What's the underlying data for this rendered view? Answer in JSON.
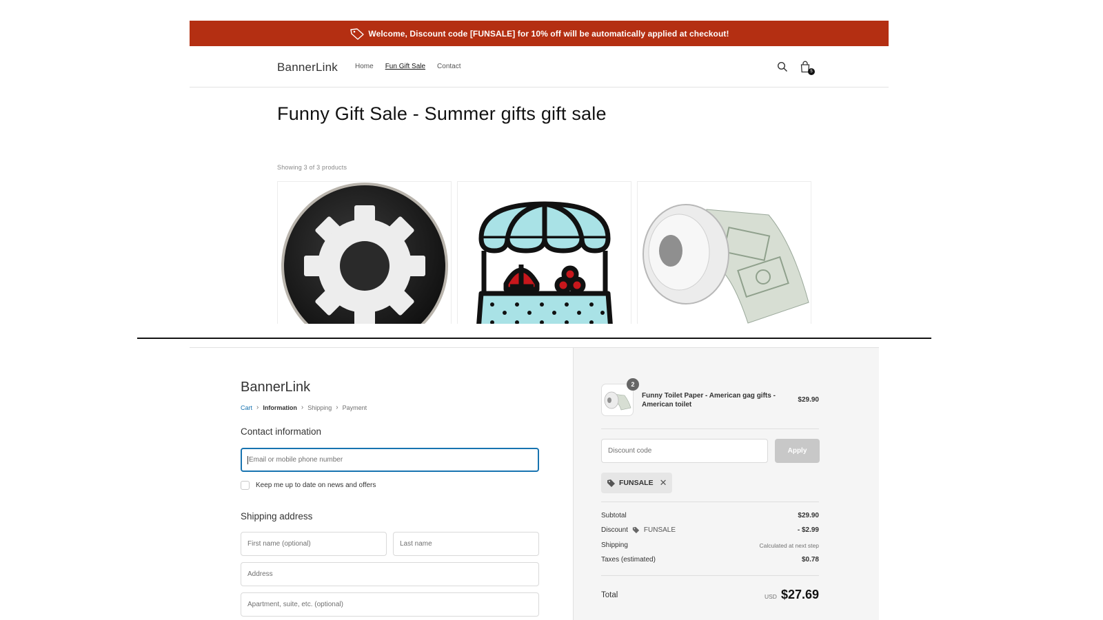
{
  "store": {
    "announcement": "Welcome, Discount code [FUNSALE] for 10% off will be automatically applied at checkout!",
    "logo": "BannerLink",
    "nav": [
      "Home",
      "Fun Gift Sale",
      "Contact"
    ],
    "cart_count": "5",
    "page_title": "Funny Gift Sale - Summer gifts gift sale",
    "showing": "Showing 3 of 3 products",
    "products": [
      {
        "icon": "gear-icon"
      },
      {
        "icon": "market-stall-icon"
      },
      {
        "icon": "toilet-paper-image"
      }
    ],
    "colors": {
      "banner": "#b42f12",
      "text": "#121212"
    }
  },
  "checkout": {
    "logo": "BannerLink",
    "breadcrumb": [
      "Cart",
      "Information",
      "Shipping",
      "Payment"
    ],
    "contact_heading": "Contact information",
    "email_placeholder": "Email or mobile phone number",
    "newsletter_label": "Keep me up to date on news and offers",
    "shipping_heading": "Shipping address",
    "first_name_placeholder": "First name (optional)",
    "last_name_placeholder": "Last name",
    "address_placeholder": "Address",
    "apartment_placeholder": "Apartment, suite, etc. (optional)",
    "item": {
      "name": "Funny Toilet Paper - American gag gifts - American toilet",
      "quantity": "2",
      "price": "$29.90"
    },
    "discount_placeholder": "Discount code",
    "apply_label": "Apply",
    "applied_code": "FUNSALE",
    "summary": {
      "subtotal_label": "Subtotal",
      "subtotal": "$29.90",
      "discount_label": "Discount",
      "discount_code": "FUNSALE",
      "discount": "- $2.99",
      "shipping_label": "Shipping",
      "shipping": "Calculated at next step",
      "taxes_label": "Taxes (estimated)",
      "taxes": "$0.78",
      "total_label": "Total",
      "currency": "USD",
      "total": "$27.69"
    },
    "colors": {
      "link": "#1773b0",
      "sidebar": "#f5f5f5"
    }
  }
}
